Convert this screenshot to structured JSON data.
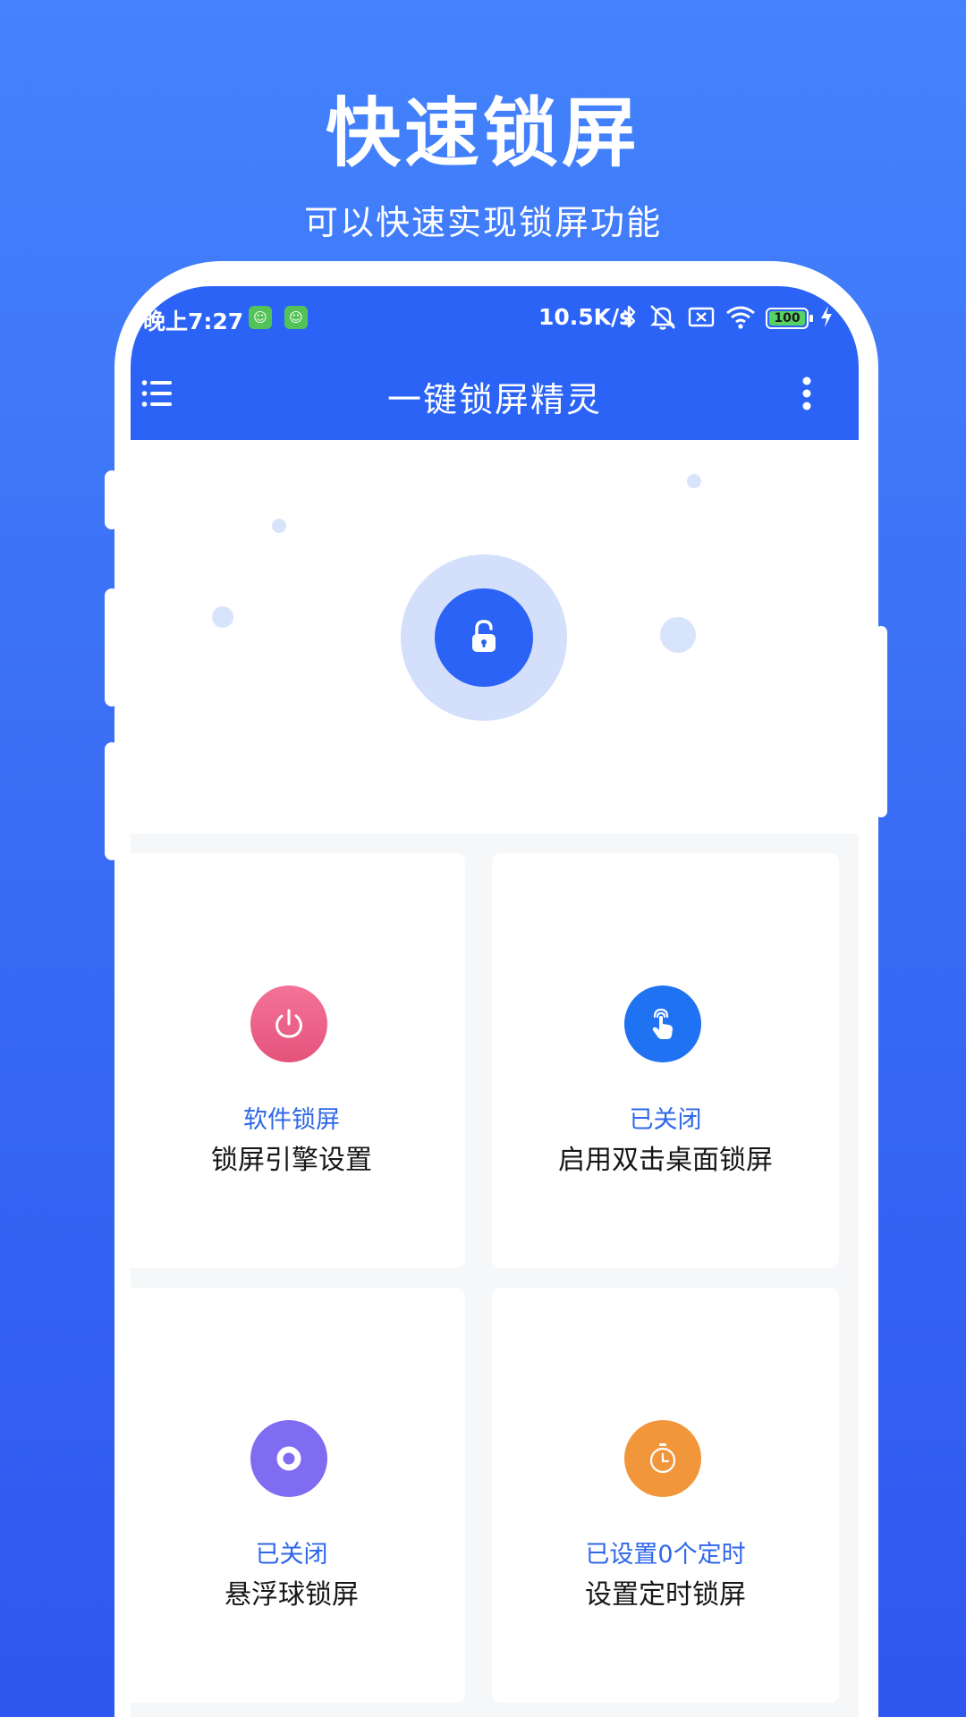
{
  "promo": {
    "title": "快速锁屏",
    "subtitle": "可以快速实现锁屏功能"
  },
  "status_bar": {
    "time": "晚上7:27",
    "network_speed": "10.5K/s",
    "battery_level": "100",
    "icons": [
      "app-notification-icon",
      "app-notification-icon",
      "bluetooth-icon",
      "mute-icon",
      "sim-off-icon",
      "wifi-icon",
      "battery-icon",
      "charging-icon"
    ]
  },
  "app_bar": {
    "title": "一键锁屏精灵",
    "menu_icon": "menu-list-icon",
    "more_icon": "more-vertical-icon"
  },
  "hero": {
    "button_icon": "lock-icon",
    "accent_color": "#2a63f6"
  },
  "cards": [
    {
      "status": "软件锁屏",
      "label": "锁屏引擎设置",
      "icon": "power-icon",
      "color": "#ea5d85"
    },
    {
      "status": "已关闭",
      "label": "启用双击桌面锁屏",
      "icon": "tap-hand-icon",
      "color": "#1f72f2"
    },
    {
      "status": "已关闭",
      "label": "悬浮球锁屏",
      "icon": "floating-ball-icon",
      "color": "#7f6cf0"
    },
    {
      "status": "已设置0个定时",
      "label": "设置定时锁屏",
      "icon": "timer-icon",
      "color": "#f2963c"
    }
  ]
}
